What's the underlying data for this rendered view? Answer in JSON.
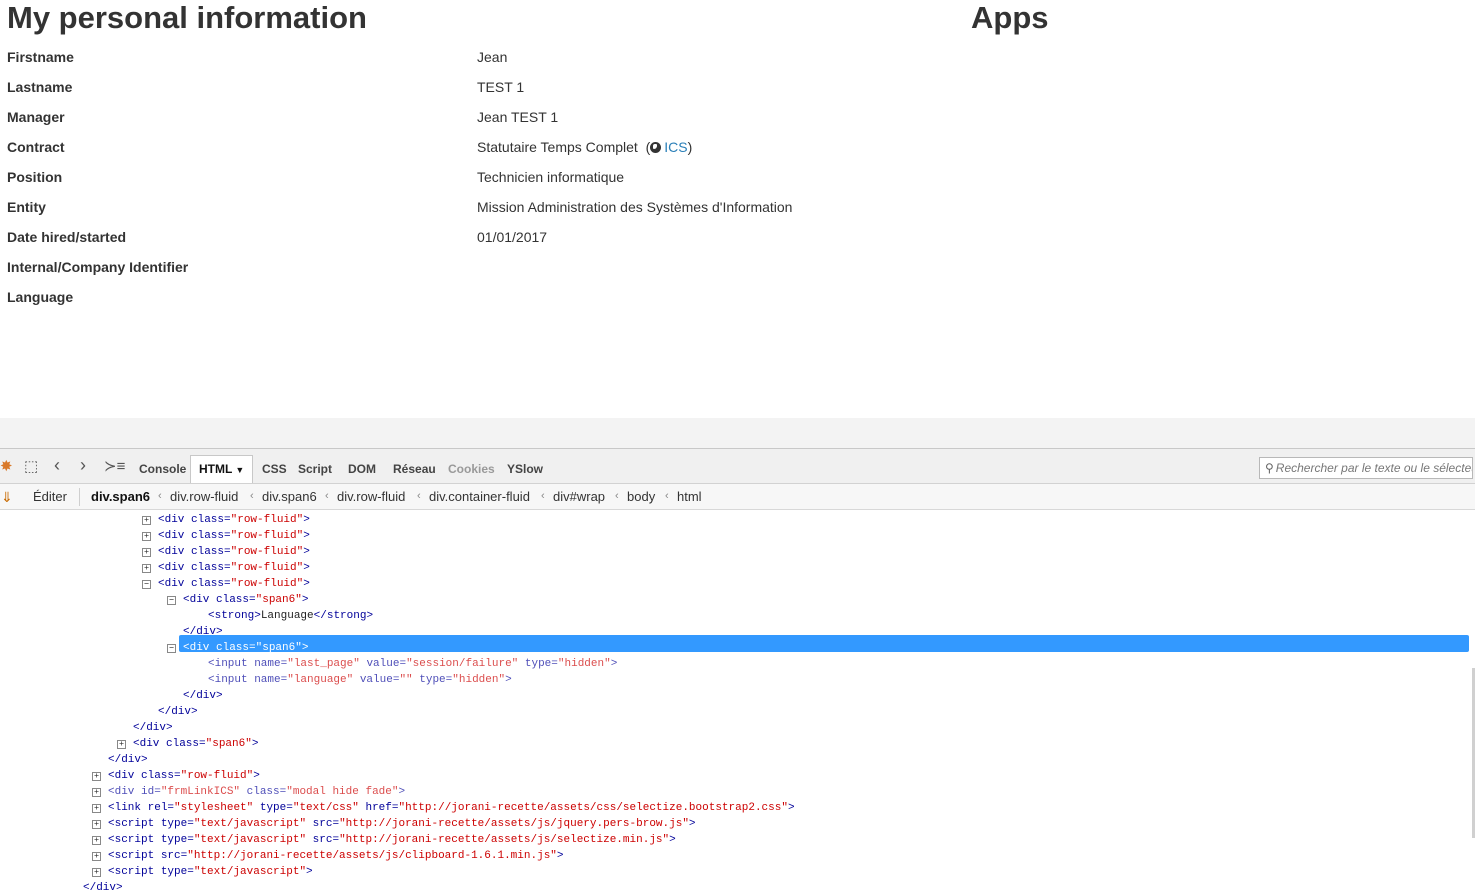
{
  "page": {
    "title": "My personal information",
    "apps_title": "Apps",
    "rows": [
      {
        "label": "Firstname",
        "value": "Jean"
      },
      {
        "label": "Lastname",
        "value": "TEST 1"
      },
      {
        "label": "Manager",
        "value": "Jean TEST 1"
      },
      {
        "label": "Contract",
        "value": "Statutaire Temps Complet",
        "extra_open": "(",
        "link": "ICS",
        "extra_close": ")"
      },
      {
        "label": "Position",
        "value": "Technicien informatique"
      },
      {
        "label": "Entity",
        "value": "Mission Administration des Systèmes d'Information"
      },
      {
        "label": "Date hired/started",
        "value": "01/01/2017"
      },
      {
        "label": "Internal/Company Identifier",
        "value": ""
      },
      {
        "label": "Language",
        "value": ""
      }
    ]
  },
  "devtools": {
    "tabs": [
      "Console",
      "HTML",
      "CSS",
      "Script",
      "DOM",
      "Réseau",
      "Cookies",
      "YSlow"
    ],
    "active_tab": "HTML",
    "search_placeholder": "Rechercher par le texte ou le sélecteur",
    "edit_label": "Éditer",
    "breadcrumbs": [
      "div.span6",
      "div.row-fluid",
      "div.span6",
      "div.row-fluid",
      "div.container-fluid",
      "div#wrap",
      "body",
      "html"
    ],
    "icons": [
      "firebug-icon",
      "inspect-icon",
      "back-icon",
      "forward-icon",
      "command-line-icon",
      "search-icon",
      "edit-icon",
      "globe-icon"
    ],
    "tree": [
      {
        "toggle": "+",
        "tag": "div",
        "attrs": [
          [
            "class",
            "row-fluid"
          ]
        ]
      },
      {
        "toggle": "+",
        "tag": "div",
        "attrs": [
          [
            "class",
            "row-fluid"
          ]
        ]
      },
      {
        "toggle": "+",
        "tag": "div",
        "attrs": [
          [
            "class",
            "row-fluid"
          ]
        ]
      },
      {
        "toggle": "+",
        "tag": "div",
        "attrs": [
          [
            "class",
            "row-fluid"
          ]
        ]
      },
      {
        "toggle": "-",
        "tag": "div",
        "attrs": [
          [
            "class",
            "row-fluid"
          ]
        ]
      },
      {
        "toggle": "-",
        "tag": "div",
        "attrs": [
          [
            "class",
            "span6"
          ]
        ]
      },
      {
        "toggle": "",
        "tag": "strong",
        "inner": "Language"
      },
      {
        "toggle": "",
        "close": "div"
      },
      {
        "toggle": "-",
        "tag": "div",
        "attrs": [
          [
            "class",
            "span6"
          ]
        ],
        "selected": true
      },
      {
        "toggle": "",
        "tag": "input",
        "attrs": [
          [
            "name",
            "last_page"
          ],
          [
            "value",
            "session/failure"
          ],
          [
            "type",
            "hidden"
          ]
        ],
        "faded": true
      },
      {
        "toggle": "",
        "tag": "input",
        "attrs": [
          [
            "name",
            "language"
          ],
          [
            "value",
            ""
          ],
          [
            "type",
            "hidden"
          ]
        ],
        "faded": true
      },
      {
        "toggle": "",
        "close": "div"
      },
      {
        "toggle": "",
        "close": "div"
      },
      {
        "toggle": "",
        "close": "div"
      },
      {
        "toggle": "+",
        "tag": "div",
        "attrs": [
          [
            "class",
            "span6"
          ]
        ]
      },
      {
        "toggle": "",
        "close": "div"
      },
      {
        "toggle": "+",
        "tag": "div",
        "attrs": [
          [
            "class",
            "row-fluid"
          ]
        ]
      },
      {
        "toggle": "+",
        "tag": "div",
        "attrs": [
          [
            "id",
            "frmLinkICS"
          ],
          [
            "class",
            "modal hide fade"
          ]
        ],
        "faded": true
      },
      {
        "toggle": "+",
        "tag": "link",
        "attrs": [
          [
            "rel",
            "stylesheet"
          ],
          [
            "type",
            "text/css"
          ],
          [
            "href",
            "http://jorani-recette/assets/css/selectize.bootstrap2.css"
          ]
        ]
      },
      {
        "toggle": "+",
        "tag": "script",
        "attrs": [
          [
            "type",
            "text/javascript"
          ],
          [
            "src",
            "http://jorani-recette/assets/js/jquery.pers-brow.js"
          ]
        ]
      },
      {
        "toggle": "+",
        "tag": "script",
        "attrs": [
          [
            "type",
            "text/javascript"
          ],
          [
            "src",
            "http://jorani-recette/assets/js/selectize.min.js"
          ]
        ]
      },
      {
        "toggle": "+",
        "tag": "script",
        "attrs": [
          [
            "src",
            "http://jorani-recette/assets/js/clipboard-1.6.1.min.js"
          ]
        ]
      },
      {
        "toggle": "+",
        "tag": "script",
        "attrs": [
          [
            "type",
            "text/javascript"
          ]
        ]
      },
      {
        "toggle": "",
        "close": "div"
      }
    ]
  }
}
